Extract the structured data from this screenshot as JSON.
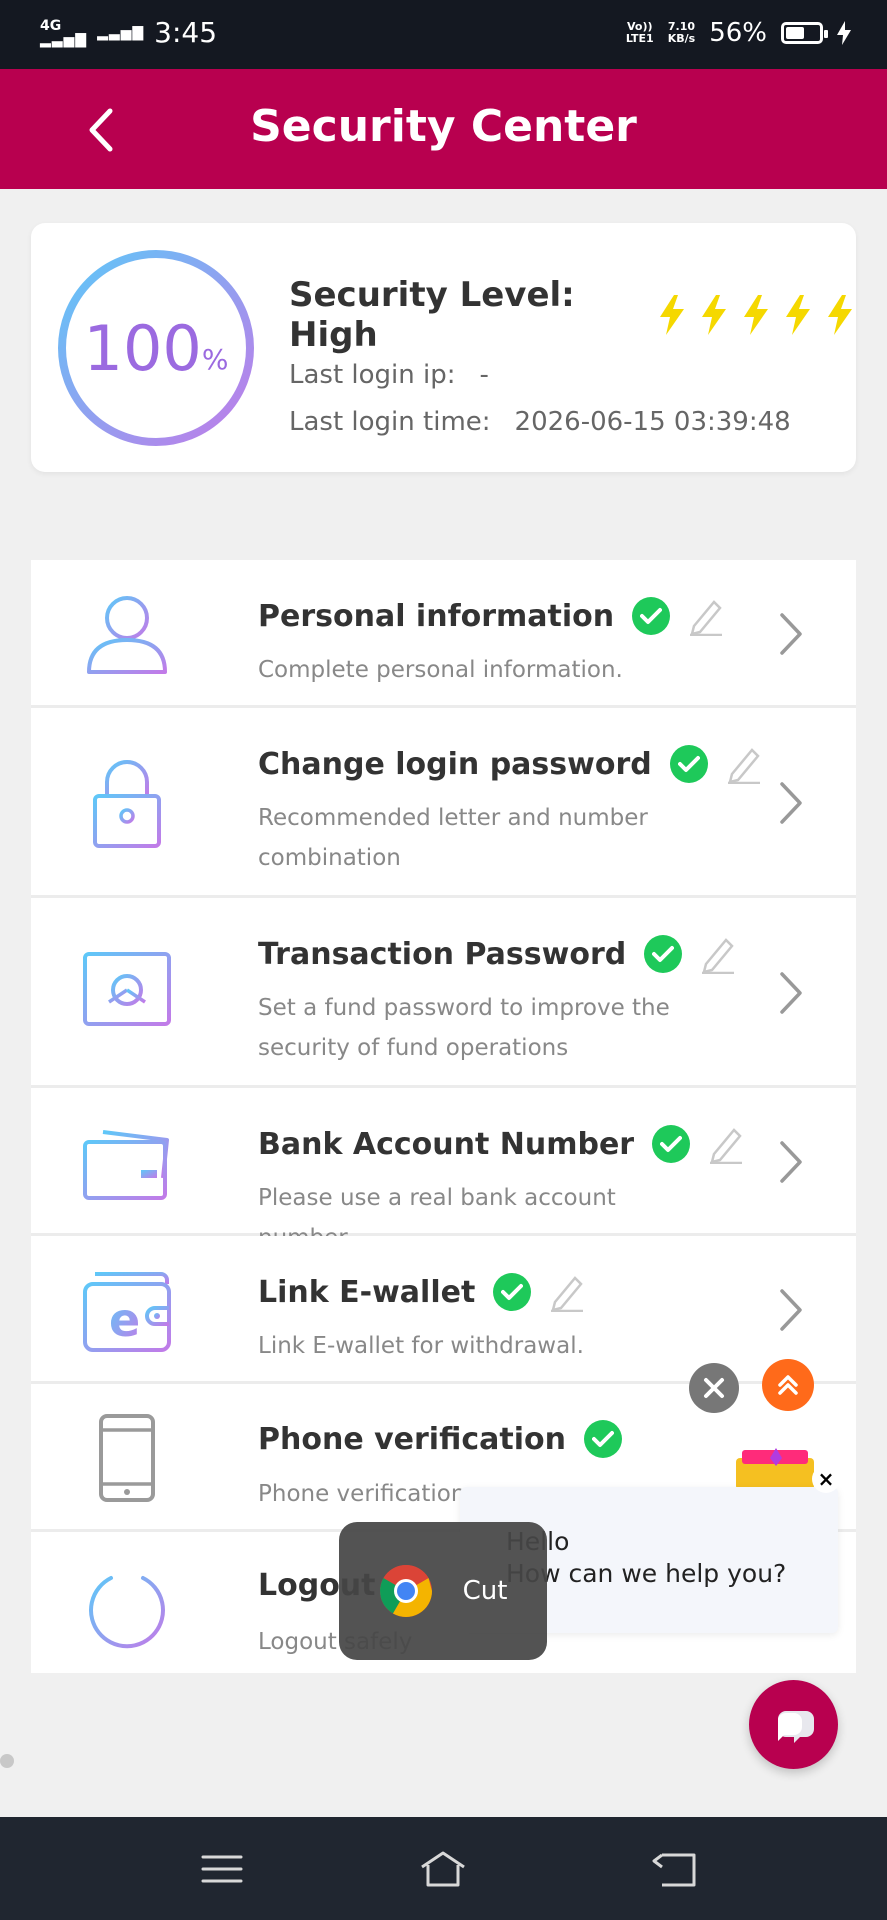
{
  "status_bar": {
    "network": "4G",
    "time": "3:45",
    "volte": "Vo))",
    "lte": "LTE1",
    "speed_value": "7.10",
    "speed_unit": "KB/s",
    "battery": "56%"
  },
  "header": {
    "title": "Security Center"
  },
  "security": {
    "percent": "100",
    "percent_sign": "%",
    "level_label": "Security Level: High",
    "level_stars": 5,
    "last_ip_label": "Last login ip:",
    "last_ip_value": "-",
    "last_time_label": "Last login time:",
    "last_time_value": "2026-06-15 03:39:48"
  },
  "menu": {
    "items": [
      {
        "label": "Personal information",
        "desc": "Complete personal information.",
        "icon": "user-icon"
      },
      {
        "label": "Change login password",
        "desc": "Recommended letter and number combination",
        "icon": "lock-icon"
      },
      {
        "label": "Transaction Password",
        "desc": "Set a fund password to improve the security of fund operations",
        "icon": "safe-icon"
      },
      {
        "label": "Bank Account Number",
        "desc": "Please use a real bank account number",
        "icon": "bank-card-icon"
      },
      {
        "label": "Link E-wallet",
        "desc": "Link E-wallet for withdrawal.",
        "icon": "wallet-icon"
      },
      {
        "label": "Phone verification",
        "desc": "Phone verification",
        "icon": "phone-icon"
      },
      {
        "label": "Logout",
        "desc": "Logout safely",
        "icon": "power-icon"
      }
    ]
  },
  "chat": {
    "greeting": "Hello",
    "question": "How can we help you?"
  },
  "toast": {
    "label": "Cut"
  },
  "colors": {
    "brand": "#b8004f",
    "check": "#1ec95a",
    "bolt": "#f5d800"
  }
}
